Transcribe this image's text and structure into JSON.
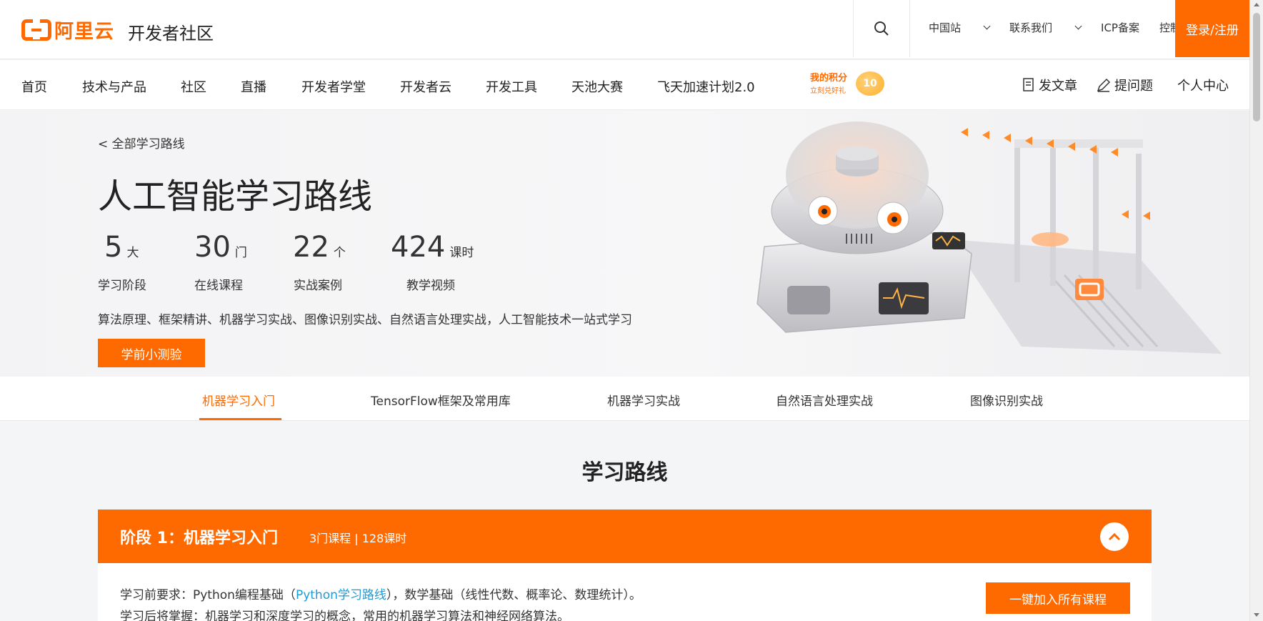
{
  "header": {
    "logo_text": "阿里云",
    "site_title": "开发者社区",
    "links": [
      "中国站",
      "联系我们",
      "ICP备案",
      "控制台"
    ],
    "login_label": "登录/注册"
  },
  "nav": {
    "items": [
      "首页",
      "技术与产品",
      "社区",
      "直播",
      "开发者学堂",
      "开发者云",
      "开发工具",
      "天池大赛",
      "飞天加速计划2.0"
    ],
    "points_title": "我的积分",
    "points_sub": "立刻兑好礼",
    "points_value": "10",
    "write_article": "发文章",
    "ask_question": "提问题",
    "personal_center": "个人中心"
  },
  "hero": {
    "back_link": "< 全部学习路线",
    "title": "人工智能学习路线",
    "stats": [
      {
        "num": "5",
        "unit": "大",
        "label": "学习阶段"
      },
      {
        "num": "30",
        "unit": "门",
        "label": "在线课程"
      },
      {
        "num": "22",
        "unit": "个",
        "label": "实战案例"
      },
      {
        "num": "424",
        "unit": "课时",
        "label": "教学视频"
      }
    ],
    "description": "算法原理、框架精讲、机器学习实战、图像识别实战、自然语言处理实战，人工智能技术一站式学习",
    "quiz_button": "学前小测验"
  },
  "tabs": [
    "机器学习入门",
    "TensorFlow框架及常用库",
    "机器学习实战",
    "自然语言处理实战",
    "图像识别实战"
  ],
  "main": {
    "section_title": "学习路线",
    "stage": {
      "name": "阶段 1：机器学习入门",
      "meta": "3门课程 | 128课时",
      "req_prefix": "学习前要求：Python编程基础（",
      "req_link": "Python学习路线",
      "req_suffix": "），数学基础（线性代数、概率论、数理统计）。",
      "after": "学习后将掌握：机器学习和深度学习的概念，常用的机器学习算法和神经网络算法。",
      "join_button": "一键加入所有课程"
    }
  },
  "colors": {
    "accent": "#ff6a00",
    "link": "#1a9bd7"
  }
}
